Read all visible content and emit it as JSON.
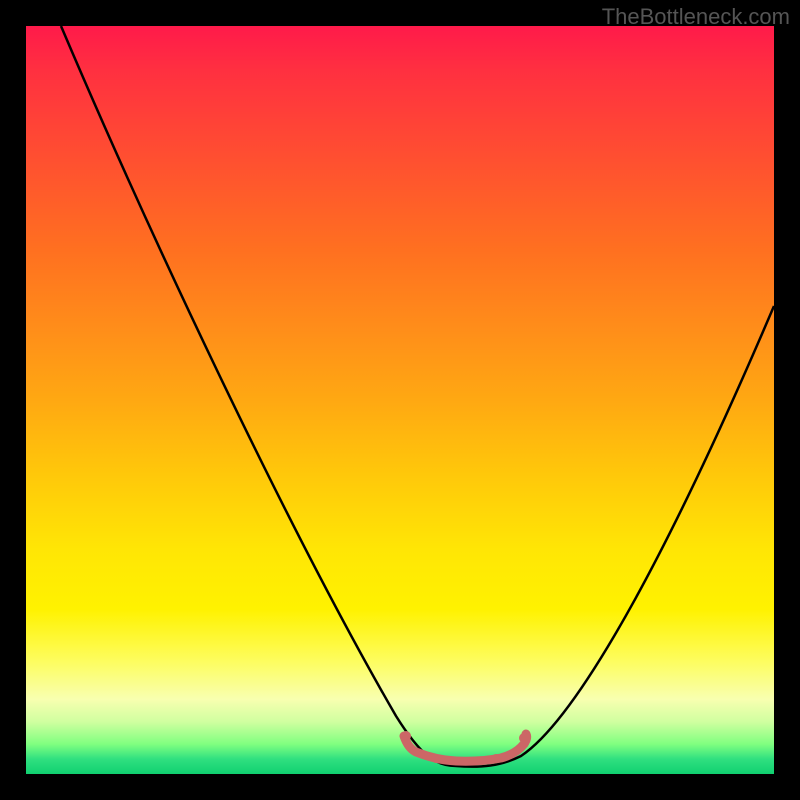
{
  "watermark": "TheBottleneck.com",
  "chart_data": {
    "type": "line",
    "title": "",
    "xlabel": "",
    "ylabel": "",
    "xlim": [
      0,
      100
    ],
    "ylim": [
      0,
      100
    ],
    "series": [
      {
        "name": "bottleneck-curve",
        "x": [
          5,
          10,
          15,
          20,
          25,
          30,
          35,
          40,
          45,
          50,
          52,
          55,
          58,
          60,
          63,
          65,
          70,
          75,
          80,
          85,
          90,
          95,
          100
        ],
        "y": [
          100,
          90,
          80,
          70,
          60,
          50,
          40,
          30,
          20,
          10,
          5,
          2,
          1,
          1,
          1,
          2,
          8,
          15,
          25,
          35,
          45,
          55,
          65
        ]
      },
      {
        "name": "optimal-zone-marker",
        "x": [
          53,
          55,
          57,
          59,
          61,
          63,
          65
        ],
        "y": [
          3,
          2,
          1.5,
          1.3,
          1.5,
          2,
          3
        ]
      }
    ],
    "background_gradient": {
      "type": "vertical",
      "stops": [
        {
          "pos": 0,
          "color": "#ff1a4a"
        },
        {
          "pos": 50,
          "color": "#ffa812"
        },
        {
          "pos": 80,
          "color": "#fff200"
        },
        {
          "pos": 100,
          "color": "#10d070"
        }
      ]
    }
  }
}
